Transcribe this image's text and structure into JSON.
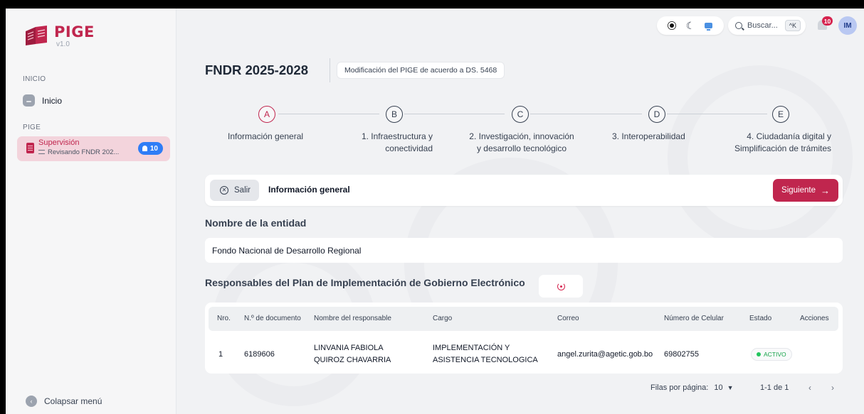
{
  "app": {
    "name": "PIGE",
    "version": "v1.0"
  },
  "sidebar": {
    "section_inicio": "INICIO",
    "inicio_label": "Inicio",
    "section_pige": "PIGE",
    "active_item": {
      "title": "Supervisión",
      "subtitle": "Revisando FNDR 202...",
      "badge": "10"
    },
    "collapse_label": "Colapsar menú"
  },
  "topbar": {
    "search_placeholder": "Buscar...",
    "shortcut": "^K",
    "notifications": "10",
    "avatar": "IM"
  },
  "page": {
    "title": "FNDR 2025-2028",
    "chip": "Modificación del PIGE de acuerdo a DS. 5468"
  },
  "steps": [
    {
      "letter": "A",
      "label": "Información general"
    },
    {
      "letter": "B",
      "label": "1. Infraestructura y",
      "label2": "conectividad"
    },
    {
      "letter": "C",
      "label": "2. Investigación, innovación",
      "label2": "y desarrollo tecnológico"
    },
    {
      "letter": "D",
      "label": "3. Interoperabilidad"
    },
    {
      "letter": "E",
      "label": "4. Ciudadanía digital y",
      "label2": "Simplificación de trámites"
    }
  ],
  "toolbar": {
    "exit": "Salir",
    "title": "Información general",
    "next": "Siguiente"
  },
  "entity": {
    "heading": "Nombre de la entidad",
    "value": "Fondo Nacional de Desarrollo Regional"
  },
  "responsables": {
    "heading": "Responsables del Plan de Implementación de Gobierno Electrónico",
    "columns": [
      "Nro.",
      "N.º de documento",
      "Nombre del responsable",
      "Cargo",
      "Correo",
      "Número de Celular",
      "Estado",
      "Acciones"
    ],
    "rows": [
      {
        "nro": "1",
        "documento": "6189606",
        "nombre1": "LINVANIA FABIOLA",
        "nombre2": "QUIROZ CHAVARRIA",
        "cargo1": "IMPLEMENTACIÓN Y",
        "cargo2": "ASISTENCIA TECNOLOGICA",
        "correo": "angel.zurita@agetic.gob.bo",
        "celular": "69802755",
        "estado": "ACTIVO"
      }
    ]
  },
  "pagination": {
    "rows_label": "Filas por página:",
    "rows_value": "10",
    "range": "1-1 de 1"
  },
  "colors": {
    "accent": "#c0264e",
    "badge": "#2f7df6",
    "active_bg": "#f3d4dc",
    "status": "#22c55e"
  }
}
